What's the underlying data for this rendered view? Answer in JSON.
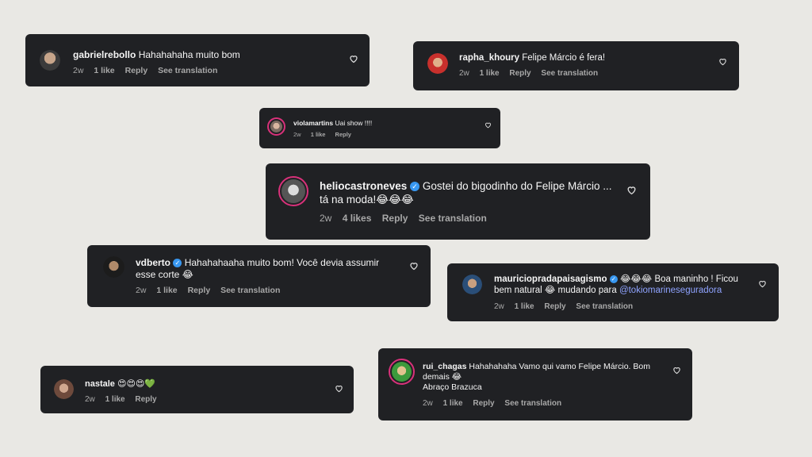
{
  "comments": [
    {
      "username": "gabrielrebollo",
      "text": "Hahahahaha muito bom",
      "time": "2w",
      "likes": "1 like",
      "reply": "Reply",
      "translate": "See translation"
    },
    {
      "username": "rapha_khoury",
      "text": "Felipe Márcio é fera!",
      "time": "2w",
      "likes": "1 like",
      "reply": "Reply",
      "translate": "See translation"
    },
    {
      "username": "violamartins",
      "text": "Uai show !!!!",
      "time": "2w",
      "likes": "1 like",
      "reply": "Reply"
    },
    {
      "username": "heliocastroneves",
      "text_line1": "Gostei do bigodinho do Felipe Márcio ...",
      "text_line2": "tá na moda!😂😂😂",
      "time": "2w",
      "likes": "4 likes",
      "reply": "Reply",
      "translate": "See translation"
    },
    {
      "username": "vdberto",
      "text_line1": "Hahahahaaha muito bom! Você devia assumir",
      "text_line2": "esse corte 😂",
      "time": "2w",
      "likes": "1 like",
      "reply": "Reply",
      "translate": "See translation"
    },
    {
      "username": "mauriciopradapaisagismo",
      "text_line1": "😂😂😂 Boa maninho ! Ficou",
      "text_line2": "bem natural 😂 mudando para",
      "mention": "@tokiomarineseguradora",
      "time": "2w",
      "likes": "1 like",
      "reply": "Reply",
      "translate": "See translation"
    },
    {
      "username": "nastale",
      "text": "😍😍😍💚",
      "time": "2w",
      "likes": "1 like",
      "reply": "Reply"
    },
    {
      "username": "rui_chagas",
      "text_line1": "Hahahahaha Vamo qui vamo Felipe Márcio. Bom",
      "text_line2": "demais 😂",
      "text_line3": "Abraço Brazuca",
      "time": "2w",
      "likes": "1 like",
      "reply": "Reply",
      "translate": "See translation"
    }
  ],
  "icons": {
    "like": "heart-outline-icon",
    "verified": "verified-badge-icon"
  },
  "colors": {
    "card": "#202124",
    "background": "#e9e8e4",
    "meta": "#a8a8a8",
    "mention": "#8fa3ff",
    "verified": "#3897f0",
    "story_ring": "#d9317a"
  }
}
